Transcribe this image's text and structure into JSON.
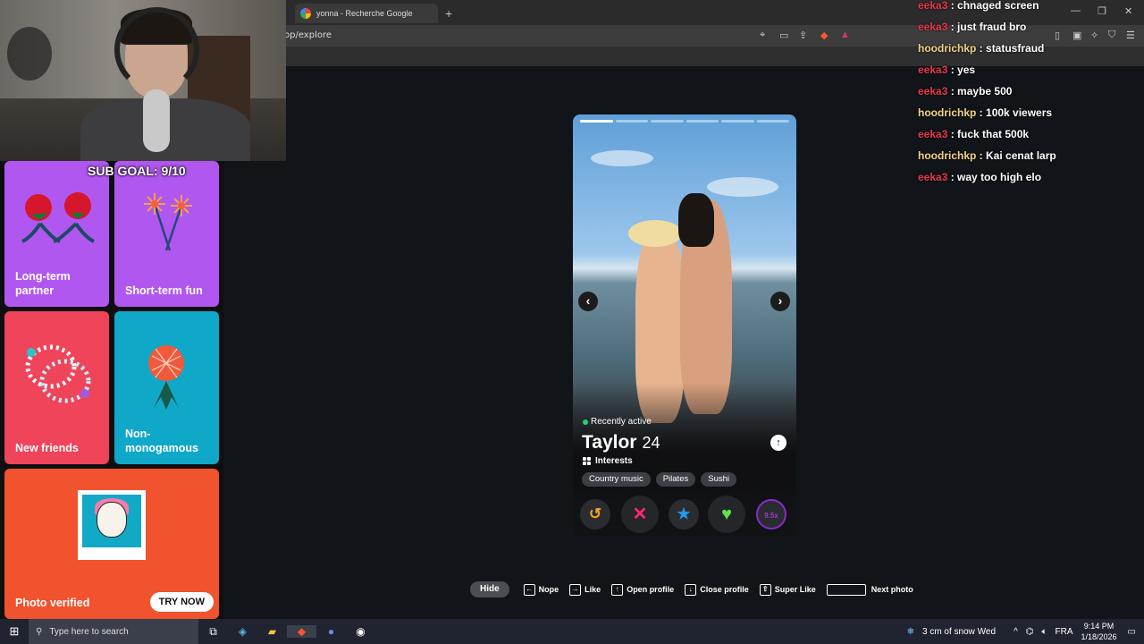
{
  "browser": {
    "tab_title": "yonna - Recherche Google",
    "new_tab": "+",
    "url": "op/explore",
    "window_controls": [
      "—",
      "❐",
      "✕"
    ]
  },
  "stream_overlay": {
    "sub_goal": "SUB GOAL: 9/10"
  },
  "purpose_cards": [
    {
      "label": "Long-term partner",
      "color": "#b057f0"
    },
    {
      "label": "Short-term fun",
      "color": "#b057f0"
    },
    {
      "label": "New friends",
      "color": "#f0445b"
    },
    {
      "label": "Non-monogamous",
      "color": "#10a8c9"
    }
  ],
  "photo_verified": {
    "label": "Photo verified",
    "button": "TRY NOW",
    "color": "#f0532e"
  },
  "profile": {
    "status": "Recently active",
    "name": "Taylor",
    "age": "24",
    "interests_title": "Interests",
    "interests": [
      "Country music",
      "Pilates",
      "Sushi"
    ],
    "photo_count": 6,
    "current_photo": 1
  },
  "actions": {
    "rewind": "↺",
    "nope": "✕",
    "super_like": "★",
    "like": "♥",
    "boost": "9.5x"
  },
  "shortcuts": {
    "hide": "Hide",
    "items": [
      {
        "key": "←",
        "label": "Nope"
      },
      {
        "key": "→",
        "label": "Like"
      },
      {
        "key": "↑",
        "label": "Open profile"
      },
      {
        "key": "↓",
        "label": "Close profile"
      },
      {
        "key": "⇧",
        "label": "Super Like"
      },
      {
        "key": "",
        "label": "Next photo"
      }
    ]
  },
  "chat": [
    {
      "user": "eeka3",
      "text": "chnaged screen",
      "color": "red"
    },
    {
      "user": "eeka3",
      "text": "just fraud bro",
      "color": "red"
    },
    {
      "user": "hoodrichkp",
      "text": "statusfraud",
      "color": "gold"
    },
    {
      "user": "eeka3",
      "text": "yes",
      "color": "red"
    },
    {
      "user": "eeka3",
      "text": "maybe 500",
      "color": "red"
    },
    {
      "user": "hoodrichkp",
      "text": "100k viewers",
      "color": "gold"
    },
    {
      "user": "eeka3",
      "text": "fuck that 500k",
      "color": "red"
    },
    {
      "user": "hoodrichkp",
      "text": "Kai cenat larp",
      "color": "gold"
    },
    {
      "user": "eeka3",
      "text": "way too high elo",
      "color": "red"
    }
  ],
  "taskbar": {
    "search_placeholder": "Type here to search",
    "weather": "3 cm of snow Wed",
    "language": "FRA",
    "time": "9:14 PM",
    "date": "1/18/2026"
  }
}
